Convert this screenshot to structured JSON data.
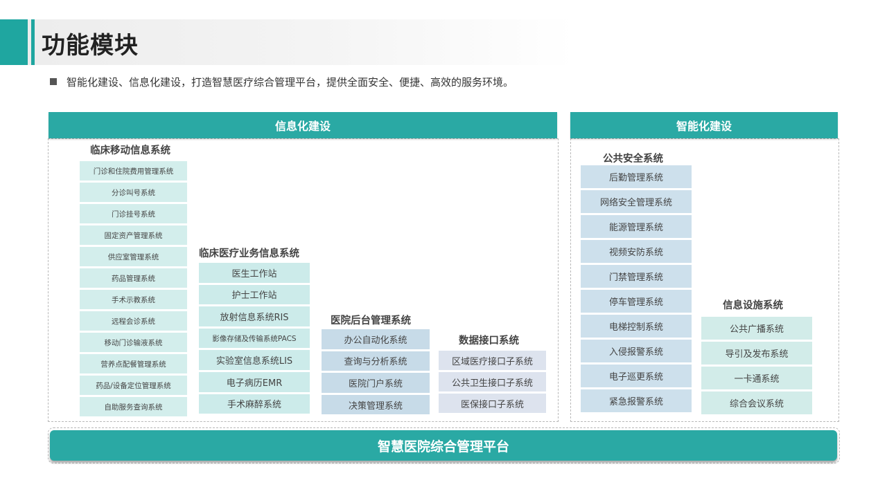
{
  "header": {
    "title": "功能模块",
    "bullet": "智能化建设、信息化建设，打造智慧医疗综合管理平台，提供全面安全、便捷、高效的服务环境。"
  },
  "info_panel": {
    "title": "信息化建设",
    "groups": [
      {
        "title": "临床移动信息系统",
        "items": [
          "门诊和住院费用管理系统",
          "分诊叫号系统",
          "门诊挂号系统",
          "固定资产管理系统",
          "供应室管理系统",
          "药品管理系统",
          "手术示教系统",
          "远程会诊系统",
          "移动门诊输液系统",
          "营养点配餐管理系统",
          "药品/设备定位管理系统",
          "自助服务查询系统"
        ]
      },
      {
        "title": "临床医疗业务信息系统",
        "items": [
          "医生工作站",
          "护士工作站",
          "放射信息系统RIS",
          "影像存储及传输系统PACS",
          "实验室信息系统LIS",
          "电子病历EMR",
          "手术麻醉系统"
        ]
      },
      {
        "title": "医院后台管理系统",
        "items": [
          "办公自动化系统",
          "查询与分析系统",
          "医院门户系统",
          "决策管理系统"
        ]
      },
      {
        "title": "数据接口系统",
        "items": [
          "区域医疗接口子系统",
          "公共卫生接口子系统",
          "医保接口子系统"
        ]
      }
    ]
  },
  "smart_panel": {
    "title": "智能化建设",
    "groups": [
      {
        "title": "公共安全系统",
        "items": [
          "后勤管理系统",
          "网络安全管理系统",
          "能源管理系统",
          "视频安防系统",
          "门禁管理系统",
          "停车管理系统",
          "电梯控制系统",
          "入侵报警系统",
          "电子巡更系统",
          "紧急报警系统"
        ]
      },
      {
        "title": "信息设施系统",
        "items": [
          "公共广播系统",
          "导引及发布系统",
          "一卡通系统",
          "综合会议系统"
        ]
      }
    ]
  },
  "platform": {
    "label": "智慧医院综合管理平台"
  },
  "colors": {
    "accent": "#2aa9a4",
    "title_block": "#1fa6a0"
  }
}
